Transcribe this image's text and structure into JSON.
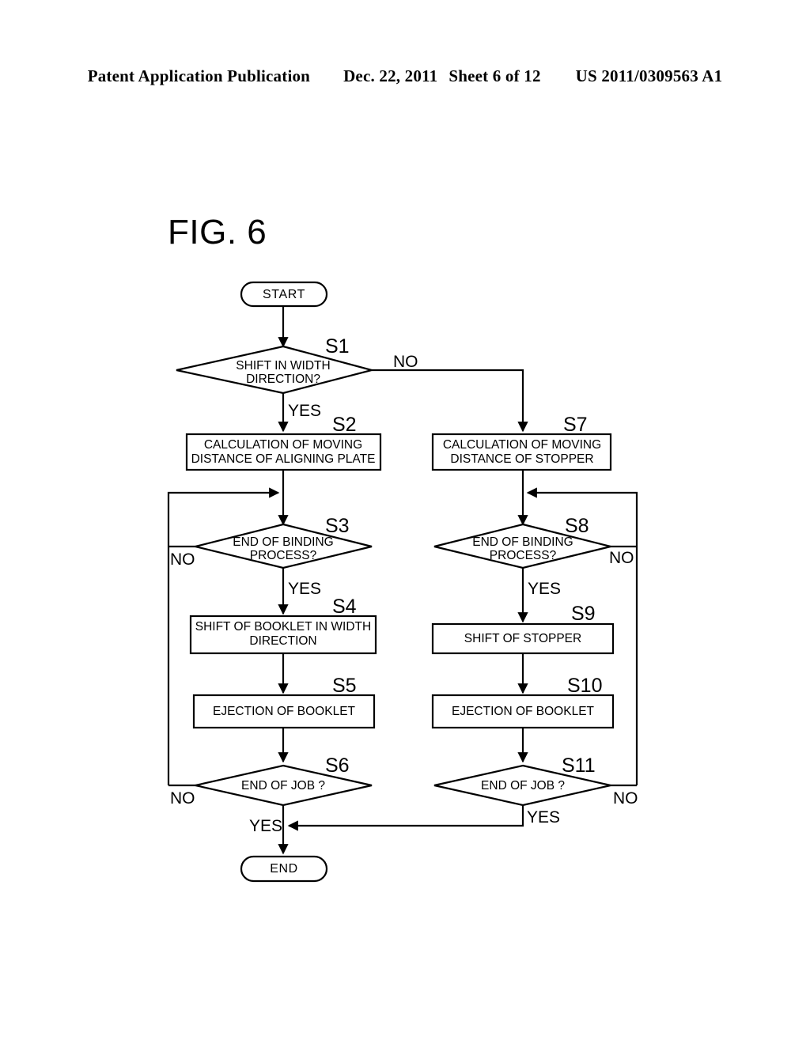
{
  "header": {
    "publication": "Patent Application Publication",
    "date": "Dec. 22, 2011",
    "sheet": "Sheet 6 of 12",
    "number": "US 2011/0309563 A1"
  },
  "figure": {
    "title": "FIG. 6"
  },
  "chart_data": {
    "type": "diagram",
    "diagram_type": "flowchart",
    "title": "FIG. 6",
    "nodes": [
      {
        "id": "start",
        "shape": "terminator",
        "label": "START"
      },
      {
        "id": "S1",
        "shape": "decision",
        "step": "S1",
        "label_line1": "SHIFT IN WIDTH",
        "label_line2": "DIRECTION?"
      },
      {
        "id": "S2",
        "shape": "process",
        "step": "S2",
        "label_line1": "CALCULATION OF MOVING",
        "label_line2": "DISTANCE OF ALIGNING PLATE"
      },
      {
        "id": "S3",
        "shape": "decision",
        "step": "S3",
        "label_line1": "END OF BINDING",
        "label_line2": "PROCESS?"
      },
      {
        "id": "S4",
        "shape": "process",
        "step": "S4",
        "label_line1": "SHIFT OF BOOKLET IN WIDTH",
        "label_line2": "DIRECTION"
      },
      {
        "id": "S5",
        "shape": "process",
        "step": "S5",
        "label_line1": "EJECTION OF BOOKLET",
        "label_line2": ""
      },
      {
        "id": "S6",
        "shape": "decision",
        "step": "S6",
        "label_line1": "END OF JOB ?",
        "label_line2": ""
      },
      {
        "id": "S7",
        "shape": "process",
        "step": "S7",
        "label_line1": "CALCULATION OF MOVING",
        "label_line2": "DISTANCE OF STOPPER"
      },
      {
        "id": "S8",
        "shape": "decision",
        "step": "S8",
        "label_line1": "END OF BINDING",
        "label_line2": "PROCESS?"
      },
      {
        "id": "S9",
        "shape": "process",
        "step": "S9",
        "label_line1": "SHIFT OF STOPPER",
        "label_line2": ""
      },
      {
        "id": "S10",
        "shape": "process",
        "step": "S10",
        "label_line1": "EJECTION OF BOOKLET",
        "label_line2": ""
      },
      {
        "id": "S11",
        "shape": "decision",
        "step": "S11",
        "label_line1": "END OF JOB ?",
        "label_line2": ""
      },
      {
        "id": "end",
        "shape": "terminator",
        "label": "END"
      }
    ],
    "edges": [
      {
        "from": "start",
        "to": "S1",
        "label": ""
      },
      {
        "from": "S1",
        "to": "S2",
        "label": "YES"
      },
      {
        "from": "S1",
        "to": "S7",
        "label": "NO"
      },
      {
        "from": "S2",
        "to": "S3",
        "label": ""
      },
      {
        "from": "S3",
        "to": "S4",
        "label": "YES"
      },
      {
        "from": "S3",
        "to": "S3",
        "label": "NO"
      },
      {
        "from": "S4",
        "to": "S5",
        "label": ""
      },
      {
        "from": "S5",
        "to": "S6",
        "label": ""
      },
      {
        "from": "S6",
        "to": "end",
        "label": "YES"
      },
      {
        "from": "S6",
        "to": "S3",
        "label": "NO"
      },
      {
        "from": "S7",
        "to": "S8",
        "label": ""
      },
      {
        "from": "S8",
        "to": "S9",
        "label": "YES"
      },
      {
        "from": "S8",
        "to": "S8",
        "label": "NO"
      },
      {
        "from": "S9",
        "to": "S10",
        "label": ""
      },
      {
        "from": "S10",
        "to": "S11",
        "label": ""
      },
      {
        "from": "S11",
        "to": "end",
        "label": "YES"
      },
      {
        "from": "S11",
        "to": "S8",
        "label": "NO"
      }
    ],
    "branch_labels": {
      "s1_yes": "YES",
      "s1_no": "NO",
      "s3_yes": "YES",
      "s3_no": "NO",
      "s6_yes": "YES",
      "s6_no": "NO",
      "s8_yes": "YES",
      "s8_no": "NO",
      "s11_yes": "YES",
      "s11_no": "NO"
    },
    "colors": {
      "stroke": "#000000",
      "fill": "#ffffff",
      "text": "#000000"
    }
  }
}
